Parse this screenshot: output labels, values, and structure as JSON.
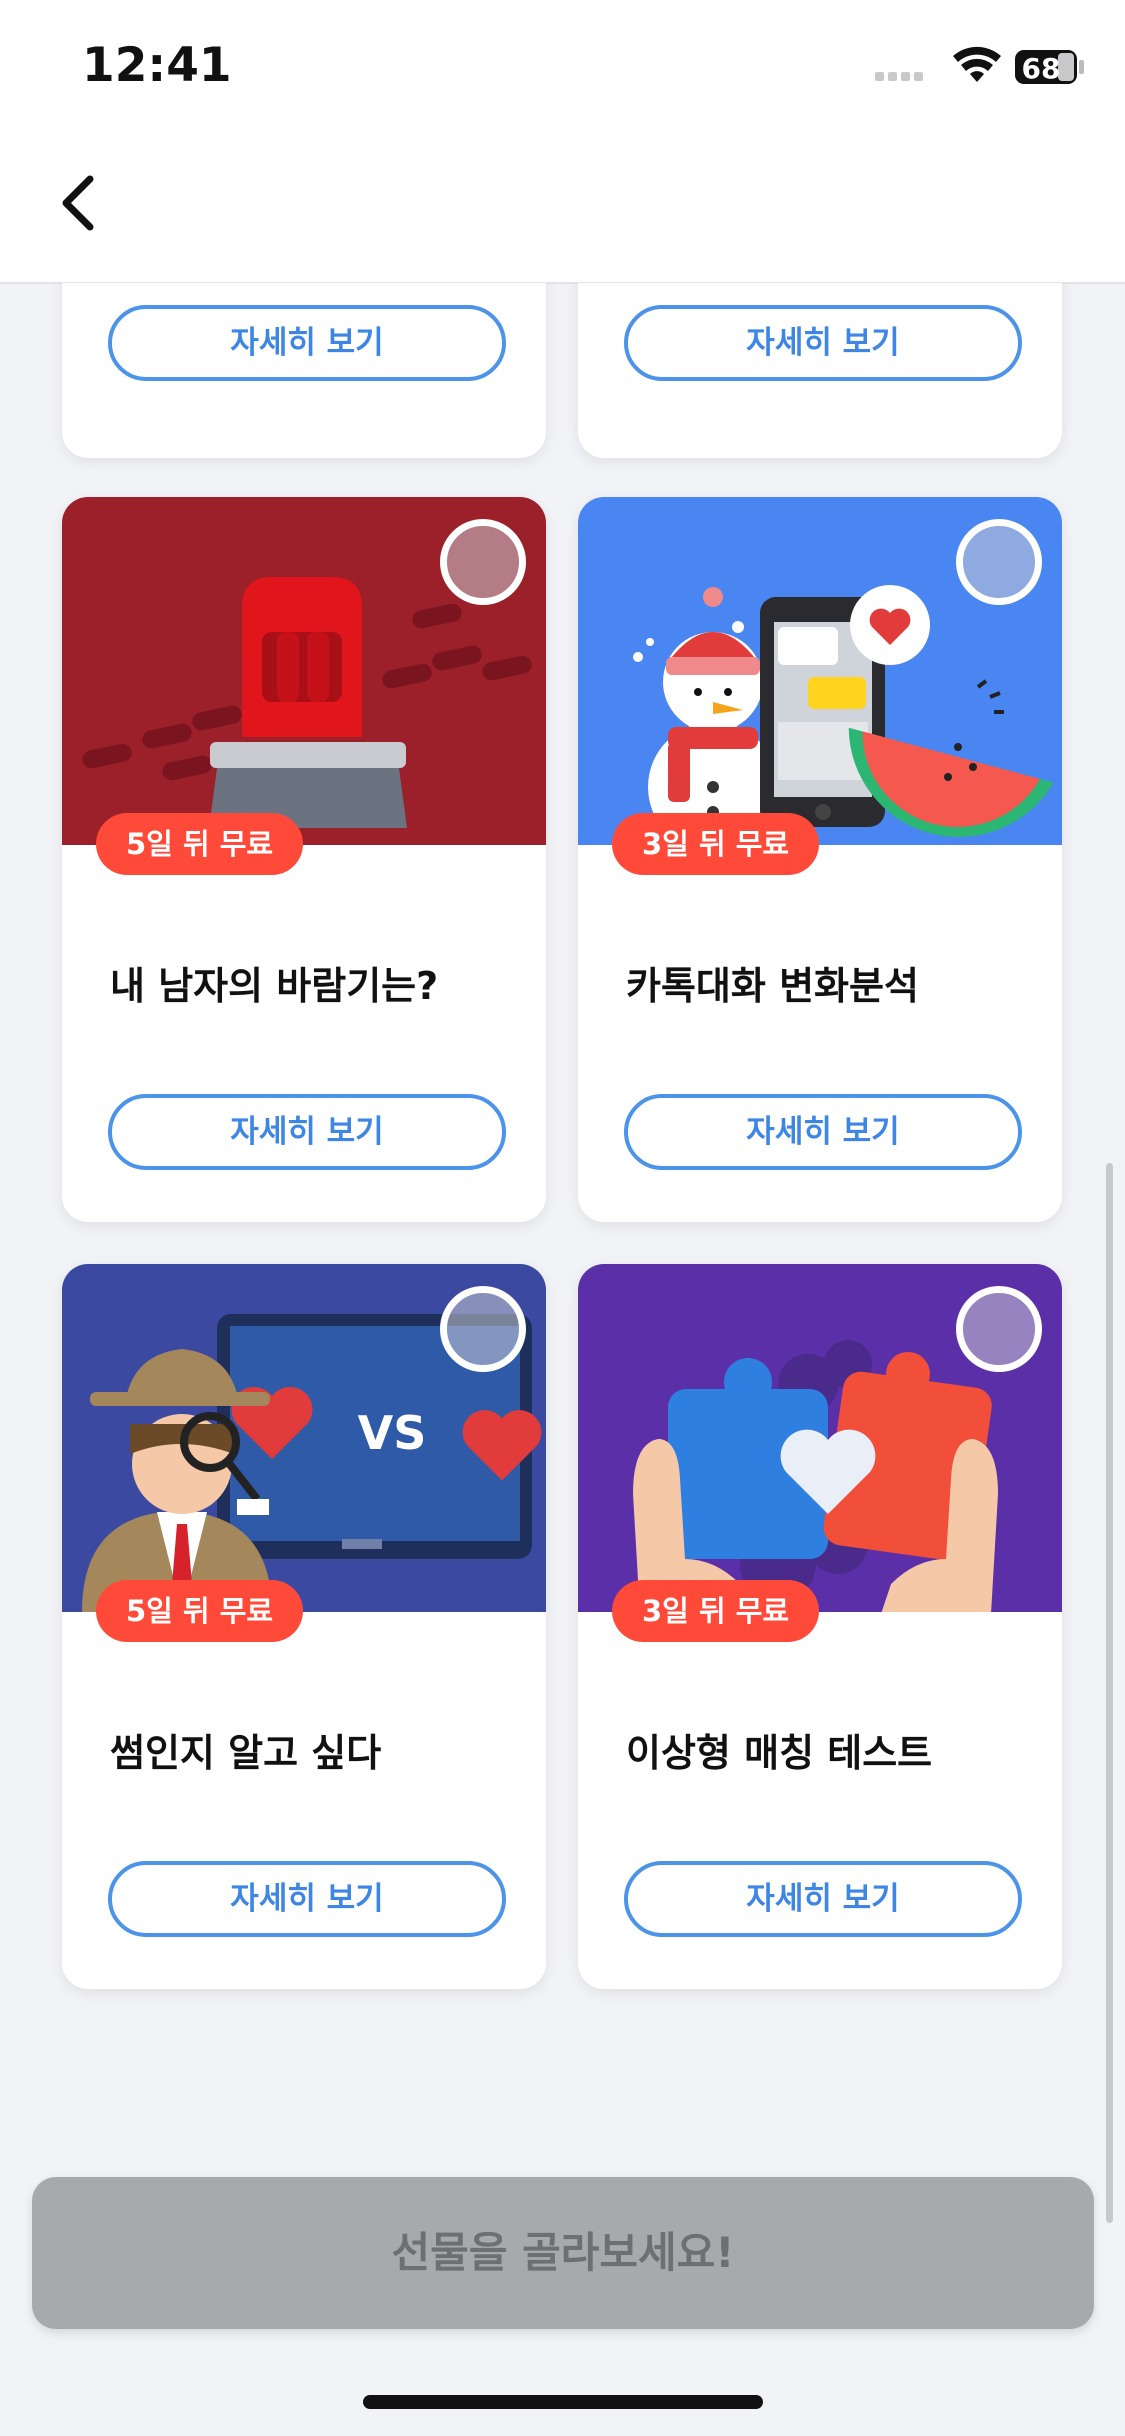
{
  "status_bar": {
    "time": "12:41",
    "battery": "68"
  },
  "nav": {
    "back_icon": "chevron-left-icon"
  },
  "top_row": [
    {
      "button": "자세히 보기"
    },
    {
      "button": "자세히 보기"
    }
  ],
  "cards": [
    {
      "badge": "5일 뒤 무료",
      "title": "내 남자의 바람기는?",
      "button": "자세히 보기",
      "bg": "#9b2029",
      "icon": "siren-icon"
    },
    {
      "badge": "3일 뒤 무료",
      "title": "카톡대화 변화분석",
      "button": "자세히 보기",
      "bg": "#4a86f2",
      "icon": "snowman-phone-icon"
    },
    {
      "badge": "5일 뒤 무료",
      "title": "썸인지 알고 싶다",
      "button": "자세히 보기",
      "bg": "#3b4aa0",
      "icon": "detective-icon",
      "vs": "VS"
    },
    {
      "badge": "3일 뒤 무료",
      "title": "이상형 매칭 테스트",
      "button": "자세히 보기",
      "bg": "#5b2fa8",
      "icon": "puzzle-heart-icon"
    }
  ],
  "cta": {
    "label": "선물을 골라보세요!"
  }
}
